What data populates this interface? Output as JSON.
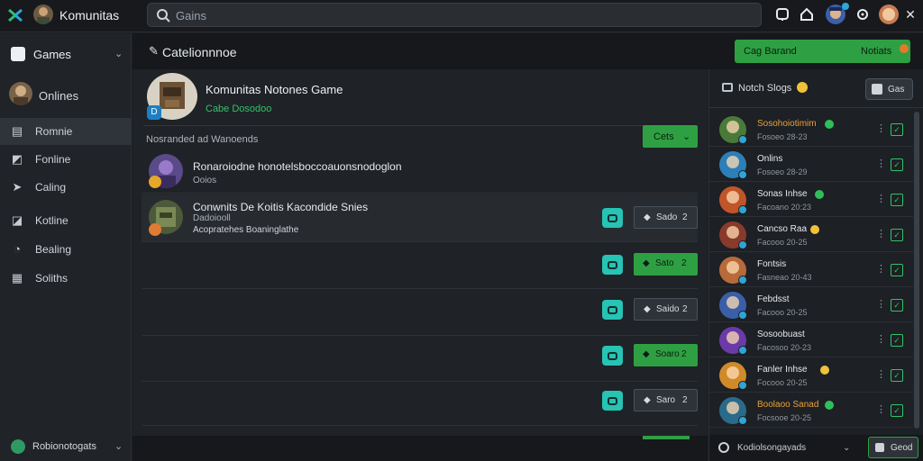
{
  "app": {
    "title": "Komunitas"
  },
  "search": {
    "placeholder": "Gains"
  },
  "sidebar": {
    "games_label": "Games",
    "online_label": "Onlines",
    "items": [
      {
        "label": "Romnie",
        "icon": "server-icon",
        "active": true
      },
      {
        "label": "Fonline",
        "icon": "chart-icon",
        "active": false
      },
      {
        "label": "Caling",
        "icon": "send-icon",
        "active": false
      },
      {
        "label": "Kotline",
        "icon": "tag-icon",
        "active": false
      },
      {
        "label": "Bealing",
        "icon": "clock-icon",
        "active": false
      },
      {
        "label": "Soliths",
        "icon": "grid-icon",
        "active": false
      }
    ],
    "footer_label": "Robionotogats"
  },
  "header": {
    "title": "Catelionnnoe",
    "green_bar": {
      "left": "Cag Barand",
      "right": "Notiats"
    }
  },
  "game": {
    "name": "Komunitas Notones Game",
    "meta": "Cabe  Dosodoo",
    "badge": "D"
  },
  "section": {
    "label": "Nosranded ad Wanoends",
    "filter_label": "Cets"
  },
  "feed": [
    {
      "title": "Ronaroiodne honotelsboccoauonsnodoglon",
      "sub": "Ooios",
      "actions": false
    },
    {
      "title": "Conwnits De Koitis Kacondide Snies",
      "sub": "Dadoiooll",
      "sub2": "Acopratehes  Boaninglathe",
      "actions": true,
      "btn_label": "Sado",
      "btn_num": "2",
      "btn_style": "dark"
    },
    {
      "actions": true,
      "btn_label": "Sato",
      "btn_num": "2",
      "btn_style": "green"
    },
    {
      "actions": true,
      "btn_label": "Saido",
      "btn_num": "2",
      "btn_style": "dark"
    },
    {
      "actions": true,
      "btn_label": "Soaro",
      "btn_num": "2",
      "btn_style": "green"
    },
    {
      "actions": true,
      "btn_label": "Saro",
      "btn_num": "2",
      "btn_style": "dark"
    }
  ],
  "right_panel": {
    "title": "Notch Slogs",
    "button": "Gas",
    "friends": [
      {
        "name": "Sosohoiotimim",
        "sub": "Fosoeo 28-23",
        "indicator": "green",
        "name_color": "#e8a23a"
      },
      {
        "name": "Onlins",
        "sub": "Fosoeo 28-29",
        "indicator": "none",
        "name_color": "#e6eaee"
      },
      {
        "name": "Sonas Inhse",
        "sub": "Facoano 20:23",
        "indicator": "green",
        "name_color": "#e6eaee"
      },
      {
        "name": "Cancso Raa",
        "sub": "Facooo 20-25",
        "indicator": "yellow",
        "name_color": "#e6eaee"
      },
      {
        "name": "Fontsis",
        "sub": "Fasneao 20-43",
        "indicator": "none",
        "name_color": "#e6eaee"
      },
      {
        "name": "Febdsst",
        "sub": "Facooo 20-25",
        "indicator": "none",
        "name_color": "#e6eaee"
      },
      {
        "name": "Sosoobuast",
        "sub": "Facosoo 20-23",
        "indicator": "none",
        "name_color": "#e6eaee"
      },
      {
        "name": "Fanler Inhse",
        "sub": "Focooo 20-25",
        "indicator": "yellow",
        "name_color": "#e6eaee"
      },
      {
        "name": "Boolaoo Sanad",
        "sub": "Focsooe 20-25",
        "indicator": "green",
        "name_color": "#e8a23a"
      }
    ],
    "footer_text": "Kodiolsongayads",
    "footer_button": "Geod"
  },
  "colors": {
    "accent_green": "#2ea043",
    "teal": "#27c3b4",
    "bg": "#1b1e22"
  }
}
